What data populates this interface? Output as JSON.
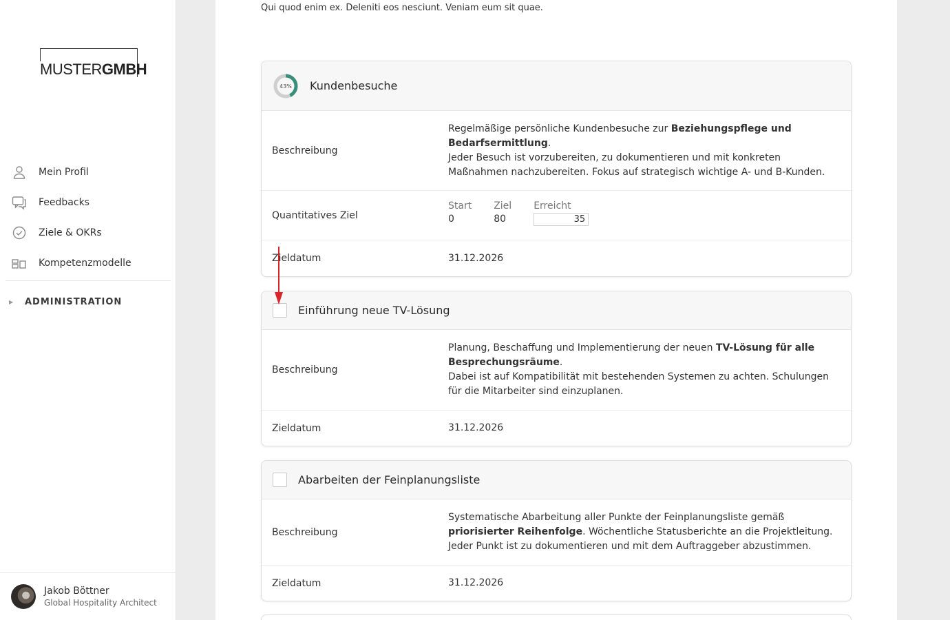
{
  "brand": {
    "logo_light": "MUSTER",
    "logo_bold": "GMBH"
  },
  "nav": {
    "items": [
      {
        "label": "Mein Profil",
        "icon": "user-icon"
      },
      {
        "label": "Feedbacks",
        "icon": "chat-icon"
      },
      {
        "label": "Ziele & OKRs",
        "icon": "check-circle-icon"
      },
      {
        "label": "Kompetenzmodelle",
        "icon": "blocks-icon"
      }
    ],
    "admin_label": "ADMINISTRATION"
  },
  "user": {
    "name": "Jakob Böttner",
    "role": "Global Hospitality Architect"
  },
  "intro": "Qui quod enim ex. Deleniti eos nesciunt. Veniam eum sit quae.",
  "cards": [
    {
      "title": "Kundenbesuche",
      "progress_label": "43%",
      "progress": 0.43,
      "desc_label": "Beschreibung",
      "desc_1": "Regelmäßige persönliche Kundenbesuche zur ",
      "desc_1_bold": "Beziehungspflege und Bedarfsermittlung",
      "desc_1_end": ".",
      "desc_2": "Jeder Besuch ist vorzubereiten, zu dokumentieren und mit konkreten Maßnahmen nachzubereiten. Fokus auf strategisch wichtige A- und B-Kunden.",
      "quant_label": "Quantitatives Ziel",
      "start_label": "Start",
      "start_value": "0",
      "target_label": "Ziel",
      "target_value": "80",
      "achieved_label": "Erreicht",
      "achieved_value": "35",
      "date_label": "Zieldatum",
      "date_value": "31.12.2026"
    },
    {
      "title": "Einführung neue TV-Lösung",
      "desc_label": "Beschreibung",
      "desc_1": "Planung, Beschaffung und Implementierung der neuen ",
      "desc_1_bold": "TV-Lösung für alle Besprechungsräume",
      "desc_1_end": ".",
      "desc_2": "Dabei ist auf Kompatibilität mit bestehenden Systemen zu achten. Schulungen für die Mitarbeiter sind einzuplanen.",
      "date_label": "Zieldatum",
      "date_value": "31.12.2026"
    },
    {
      "title": "Abarbeiten der Feinplanungsliste",
      "desc_label": "Beschreibung",
      "desc_1": "Systematische Abarbeitung aller Punkte der Feinplanungsliste gemäß ",
      "desc_1_bold": "priorisierter Reihenfolge",
      "desc_1_end": ". Wöchentliche Statusberichte an die Projektleitung.",
      "desc_2": "Jeder Punkt ist zu dokumentieren und mit dem Auftraggeber abzustimmen.",
      "date_label": "Zieldatum",
      "date_value": "31.12.2026"
    }
  ],
  "colors": {
    "accent": "#3a8f7c",
    "arrow": "#d9262c"
  }
}
